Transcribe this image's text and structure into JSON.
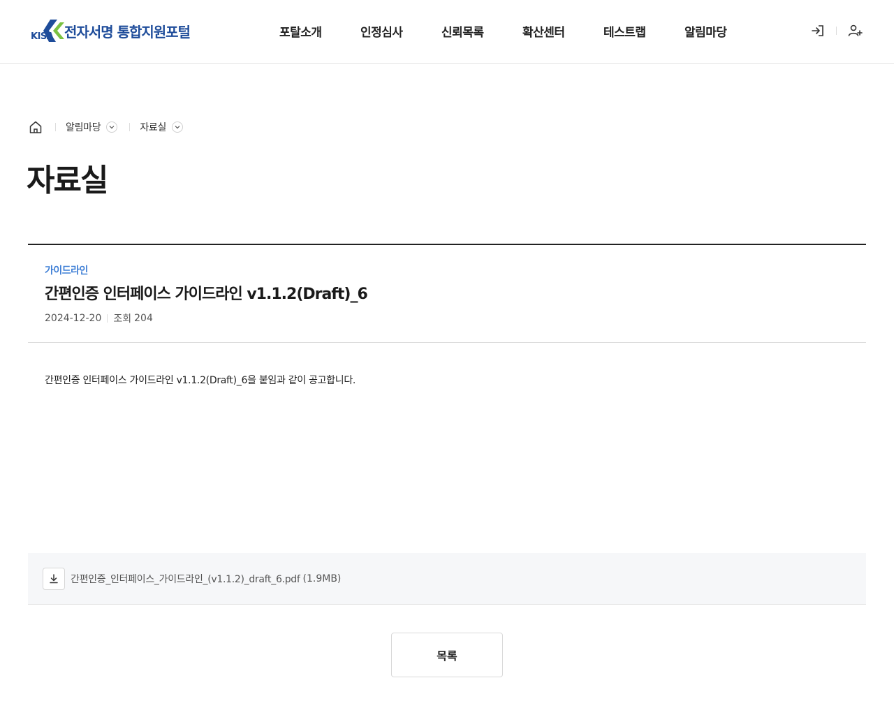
{
  "header": {
    "logo_mark": "KISA",
    "logo_text": "전자서명 통합지원포털",
    "nav": [
      "포탈소개",
      "인정심사",
      "신뢰목록",
      "확산센터",
      "테스트랩",
      "알림마당"
    ]
  },
  "breadcrumb": {
    "items": [
      "알림마당",
      "자료실"
    ]
  },
  "page": {
    "title": "자료실"
  },
  "post": {
    "category": "가이드라인",
    "title": "간편인증 인터페이스 가이드라인 v1.1.2(Draft)_6",
    "date": "2024-12-20",
    "views_label": "조회",
    "views": "204",
    "body": "간편인증 인터페이스 가이드라인 v1.1.2(Draft)_6을 붙임과 같이 공고합니다.",
    "attachment": {
      "file_name": "간편인증_인터페이스_가이드라인_(v1.1.2)_draft_6.pdf",
      "file_size": "(1.9MB)"
    }
  },
  "actions": {
    "list_label": "목록"
  },
  "colors": {
    "brand": "#1e4c9a",
    "accent_green": "#7ac142",
    "category": "#3f7fd6"
  }
}
